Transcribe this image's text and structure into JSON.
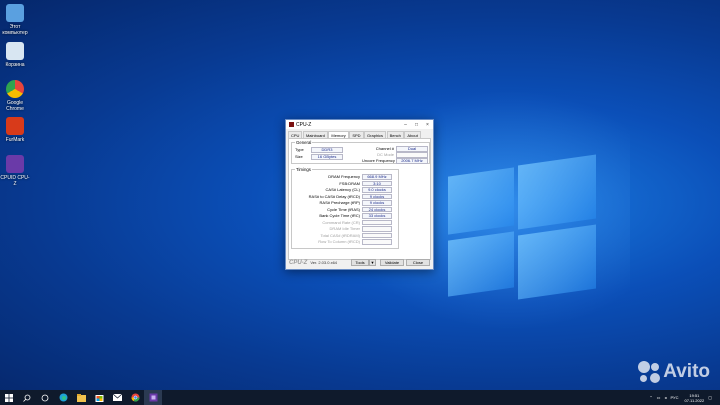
{
  "desktop": {
    "icons": [
      {
        "label": "Этот компьютер",
        "color": "#5aa0e0"
      },
      {
        "label": "Корзина",
        "color": "#d8e6f2"
      },
      {
        "label": "Google Chrome",
        "color": "#e8453c"
      },
      {
        "label": "FurMark",
        "color": "#d83a1a"
      },
      {
        "label": "CPUID CPU-Z",
        "color": "#6a3aa8"
      }
    ]
  },
  "window": {
    "title": "CPU-Z",
    "minimize": "–",
    "maximize": "□",
    "close": "×",
    "tabs": [
      "CPU",
      "Mainboard",
      "Memory",
      "SPD",
      "Graphics",
      "Bench",
      "About"
    ],
    "active_tab": "Memory",
    "general": {
      "title": "General",
      "type_label": "Type",
      "type_value": "DDR3",
      "size_label": "Size",
      "size_value": "16 GBytes",
      "channel_label": "Channel #",
      "channel_value": "Dual",
      "dcmode_label": "DC Mode",
      "dcmode_value": "",
      "uncore_label": "Uncore Frequency",
      "uncore_value": "2006.7 MHz"
    },
    "timings": {
      "title": "Timings",
      "rows": [
        {
          "label": "DRAM Frequency",
          "value": "668.9 MHz"
        },
        {
          "label": "FSB:DRAM",
          "value": "3:10"
        },
        {
          "label": "CAS# Latency (CL)",
          "value": "9.0 clocks"
        },
        {
          "label": "RAS# to CAS# Delay (tRCD)",
          "value": "9 clocks"
        },
        {
          "label": "RAS# Precharge (tRP)",
          "value": "9 clocks"
        },
        {
          "label": "Cycle Time (tRAS)",
          "value": "24 clocks"
        },
        {
          "label": "Bank Cycle Time (tRC)",
          "value": "33 clocks"
        },
        {
          "label": "Command Rate (CR)",
          "value": ""
        },
        {
          "label": "DRAM Idle Timer",
          "value": ""
        },
        {
          "label": "Total CAS# (tRDRAM)",
          "value": ""
        },
        {
          "label": "Row To Column (tRCD)",
          "value": ""
        }
      ]
    },
    "footer": {
      "brand": "CPU-Z",
      "version": "Ver. 2.03.0.x64",
      "tools_label": "Tools",
      "tools_arrow": "▼",
      "validate_label": "Validate",
      "close_label": "Close"
    }
  },
  "taskbar": {
    "start_icon": "windows-icon",
    "search_icon": "search-icon",
    "taskview_icon": "taskview-icon",
    "apps": [
      "edge-icon",
      "explorer-icon",
      "store-icon",
      "mail-icon",
      "chrome-icon",
      "cpuz-icon"
    ],
    "tray": {
      "language": "РУС",
      "time": "19:51",
      "date": "07.11.2022"
    }
  },
  "watermark": {
    "text": "Avito"
  }
}
